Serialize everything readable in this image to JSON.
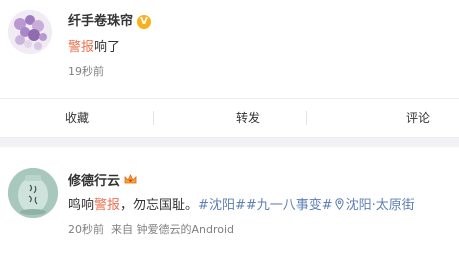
{
  "post1": {
    "author": "纤手卷珠帘",
    "verified_badge": "V",
    "content": {
      "highlight": "警报",
      "rest": "响了"
    },
    "time": "19秒前"
  },
  "actions": {
    "favorite": "收藏",
    "repost": "转发",
    "comment": "评论"
  },
  "post2": {
    "author": "修德行云",
    "content": {
      "part1": "鸣响",
      "highlight": "警报",
      "part2": "，勿忘国耻。",
      "topics": "#沈阳##九一八事变#",
      "location_icon": "location-pin-icon",
      "location": "沈阳·太原街"
    },
    "meta": "20秒前  来自 钟爱德云的Android"
  },
  "colors": {
    "keyword": "#eb7350",
    "topic": "#5d7fb4",
    "badge": "#f8b11b",
    "muted": "#808080"
  }
}
